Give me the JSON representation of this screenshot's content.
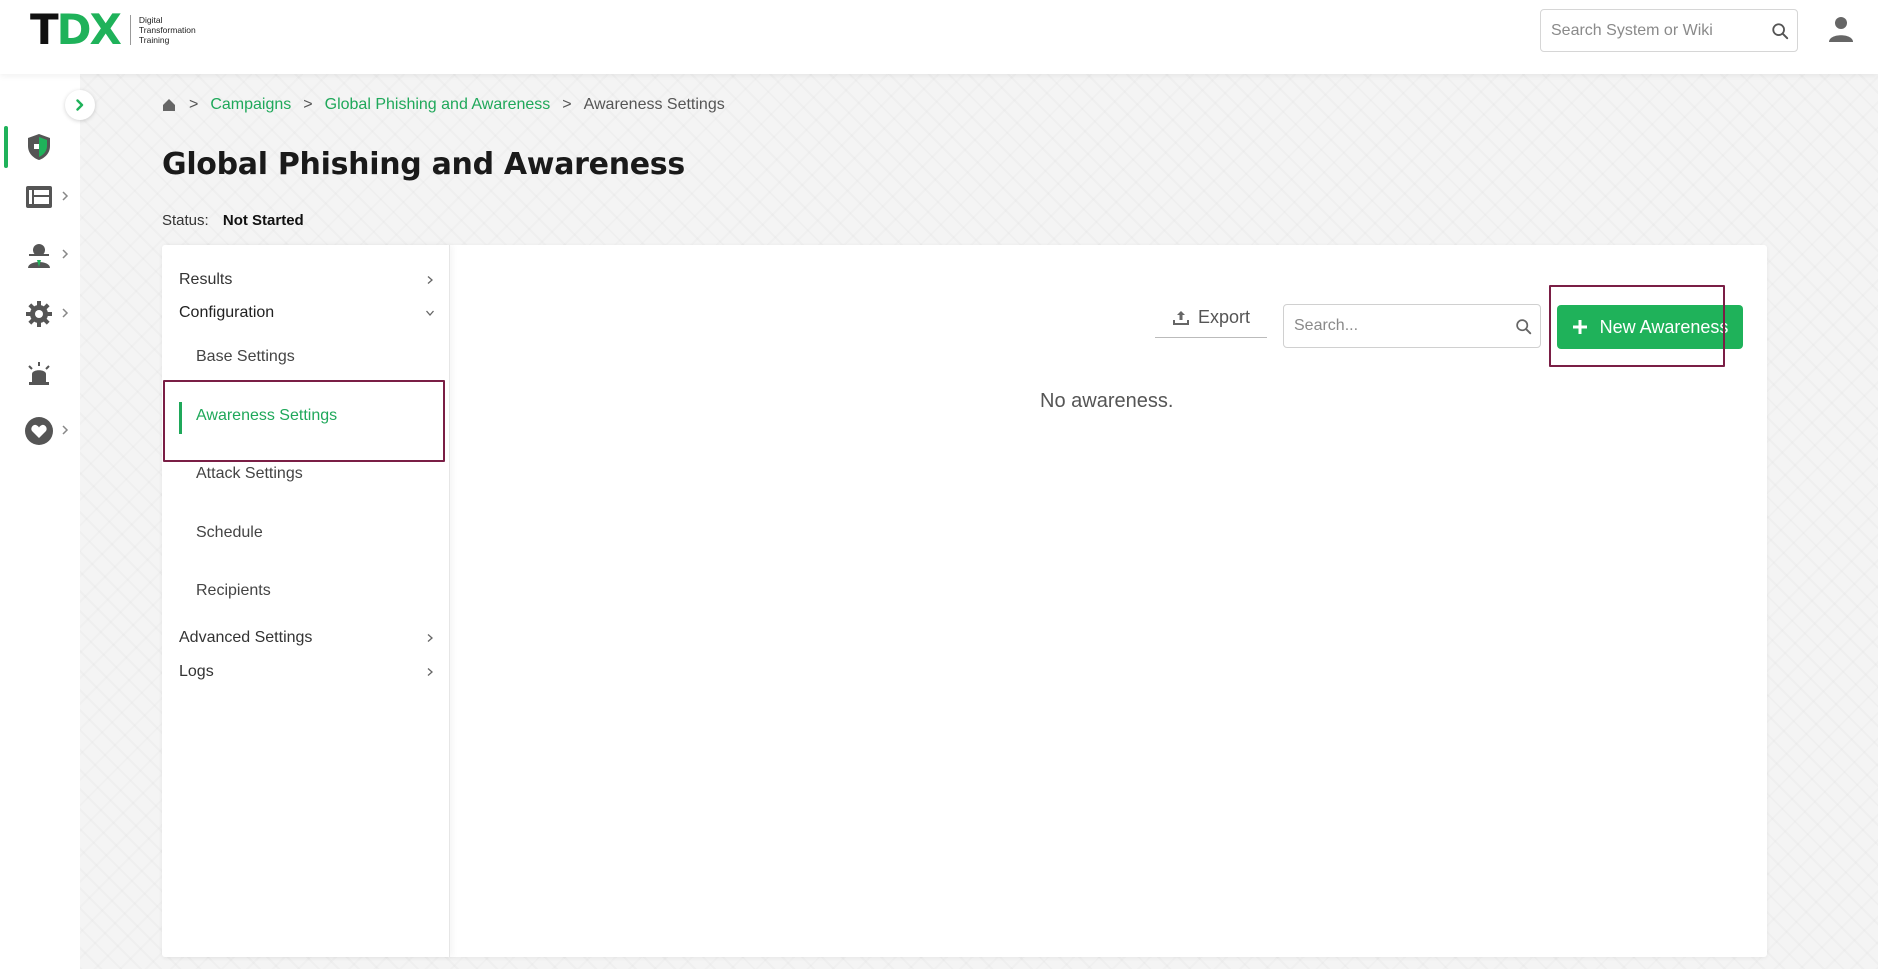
{
  "brand": {
    "logo_t": "T",
    "logo_dx": "DX",
    "logo_sub_1": "Digital",
    "logo_sub_2": "Transformation",
    "logo_sub_3": "Training",
    "accent": "#1fb25a"
  },
  "topbar": {
    "search_placeholder": "Search System or Wiki",
    "search_icon": "search-icon",
    "user_icon": "user-icon"
  },
  "rail": {
    "items": [
      {
        "icon": "shield-icon",
        "active": true
      },
      {
        "icon": "dashboard-icon",
        "has_submenu": true
      },
      {
        "icon": "user-agent-icon",
        "has_submenu": true
      },
      {
        "icon": "gear-icon",
        "has_submenu": true
      },
      {
        "icon": "alarm-icon"
      },
      {
        "icon": "heart-icon",
        "has_submenu": true
      }
    ]
  },
  "breadcrumb": {
    "sep": ">",
    "items": [
      "Campaigns",
      "Global Phishing and Awareness",
      "Awareness Settings"
    ]
  },
  "page": {
    "title": "Global Phishing and Awareness",
    "status_label": "Status:",
    "status_value": "Not Started"
  },
  "menu": {
    "results": "Results",
    "configuration": "Configuration",
    "sub_items": [
      "Base Settings",
      "Awareness Settings",
      "Attack Settings",
      "Schedule",
      "Recipients"
    ],
    "active_sub": "Awareness Settings",
    "advanced": "Advanced Settings",
    "logs": "Logs"
  },
  "toolbar": {
    "export_label": "Export",
    "search_placeholder": "Search...",
    "new_label": "New Awareness"
  },
  "empty_state": "No awareness.",
  "highlight_color": "#7a1e45"
}
